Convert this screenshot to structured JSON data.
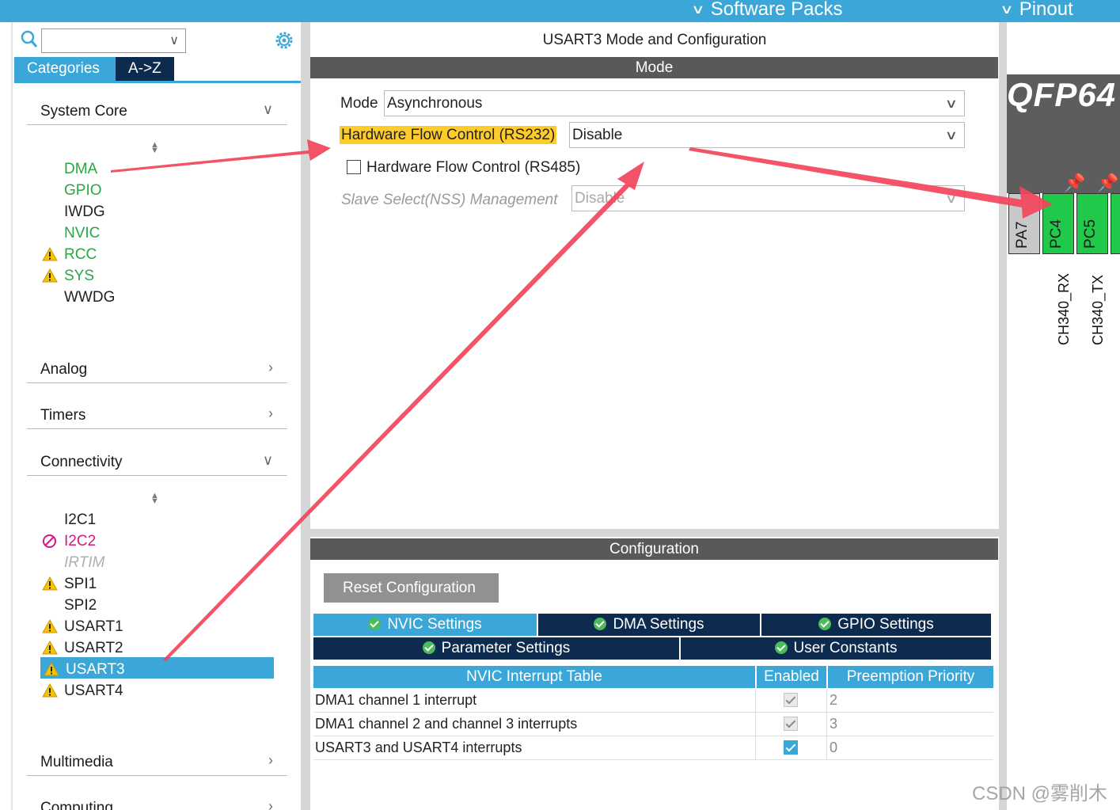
{
  "header": {
    "software_packs": "Software Packs",
    "pinout": "Pinout"
  },
  "left_panel": {
    "tabs": [
      "Categories",
      "A->Z"
    ],
    "categories": {
      "system_core": "System Core",
      "analog": "Analog",
      "timers": "Timers",
      "connectivity": "Connectivity",
      "multimedia": "Multimedia",
      "computing": "Computing"
    },
    "system_core_items": [
      "DMA",
      "GPIO",
      "IWDG",
      "NVIC",
      "RCC",
      "SYS",
      "WWDG"
    ],
    "connectivity_items": [
      "I2C1",
      "I2C2",
      "IRTIM",
      "SPI1",
      "SPI2",
      "USART1",
      "USART2",
      "USART3",
      "USART4"
    ]
  },
  "mode_config": {
    "title": "USART3 Mode and Configuration",
    "mode_section": "Mode",
    "mode_label": "Mode",
    "mode_value": "Asynchronous",
    "hfc_rs232_label": "Hardware Flow Control (RS232)",
    "hfc_rs232_value": "Disable",
    "hfc_rs485_label": "Hardware Flow Control (RS485)",
    "nss_label": "Slave Select(NSS) Management",
    "nss_value": "Disable",
    "config_section": "Configuration",
    "reset_button": "Reset Configuration",
    "settings_tabs": [
      "NVIC Settings",
      "DMA Settings",
      "GPIO Settings",
      "Parameter Settings",
      "User Constants"
    ]
  },
  "nvic_table": {
    "headers": [
      "NVIC Interrupt Table",
      "Enabled",
      "Preemption Priority"
    ],
    "rows": [
      {
        "name": "DMA1 channel 1 interrupt",
        "enabled": true,
        "priority": "2"
      },
      {
        "name": "DMA1 channel 2 and channel 3 interrupts",
        "enabled": true,
        "priority": "3"
      },
      {
        "name": "USART3 and USART4 interrupts",
        "enabled": true,
        "priority": "0"
      }
    ]
  },
  "pinout": {
    "package": "QFP64",
    "pins": [
      "PA7",
      "PC4",
      "PC5"
    ],
    "signals": [
      "CH340_RX",
      "CH340_TX"
    ]
  },
  "watermark": "CSDN @雾削木",
  "colors": {
    "accent_blue": "#3ba7d8",
    "dark_navy": "#0c2b4e",
    "section_gray": "#595959",
    "highlight_yellow": "#fdcc2b",
    "pin_green": "#21c94a",
    "annotation_red": "#f2455a",
    "item_green": "#28a745"
  }
}
